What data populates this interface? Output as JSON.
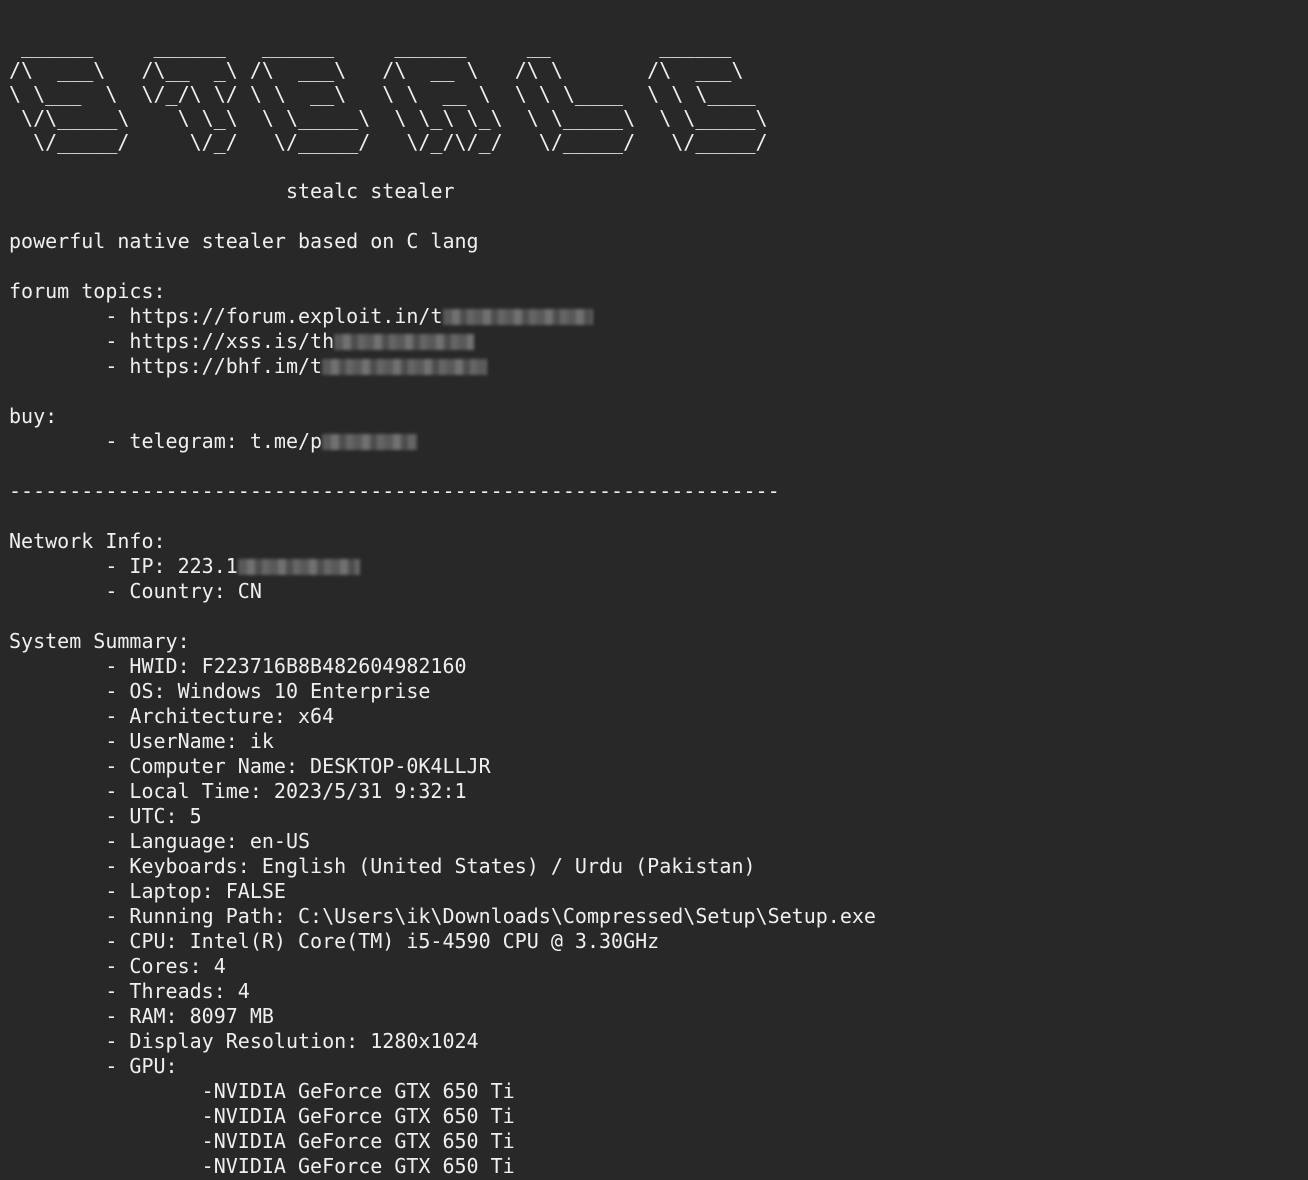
{
  "banner_lines": [
    " ______     ______   ______     ______     __         ______    ",
    "/\\  ___\\   /\\__  _\\ /\\  ___\\   /\\  __ \\   /\\ \\       /\\  ___\\   ",
    "\\ \\___  \\  \\/_/\\ \\/ \\ \\  __\\   \\ \\  __ \\  \\ \\ \\____  \\ \\ \\____  ",
    " \\/\\_____\\    \\ \\_\\  \\ \\_____\\  \\ \\_\\ \\_\\  \\ \\_____\\  \\ \\_____\\ ",
    "  \\/_____/     \\/_/   \\/_____/   \\/_/\\/_/   \\/_____/   \\/_____/ "
  ],
  "tool_name": "stealc stealer",
  "tagline": "powerful native stealer based on C lang",
  "forum_heading": "forum topics:",
  "forum_links": [
    {
      "prefix": "- ",
      "visible": "https://forum.exploit.in/t",
      "tail": ""
    },
    {
      "prefix": "- ",
      "visible": "https://xss.is/th",
      "tail": ""
    },
    {
      "prefix": "- ",
      "visible": "https://bhf.im/t",
      "tail": ""
    }
  ],
  "buy_heading": "buy:",
  "buy_items": [
    {
      "prefix": "- ",
      "visible": "telegram: t.me/p",
      "tail": ""
    }
  ],
  "separator": "----------------------------------------------------------------",
  "network_heading": "Network Info:",
  "network_items": [
    {
      "prefix": "- ",
      "visible": "IP: 223.1",
      "tail": ""
    },
    {
      "prefix": "- ",
      "visible": "Country: CN",
      "tail": ""
    }
  ],
  "system_heading": "System Summary:",
  "system_items": [
    "- HWID: F223716B8B482604982160",
    "- OS: Windows 10 Enterprise",
    "- Architecture: x64",
    "- UserName: ik",
    "- Computer Name: DESKTOP-0K4LLJR",
    "- Local Time: 2023/5/31 9:32:1",
    "- UTC: 5",
    "- Language: en-US",
    "- Keyboards: English (United States) / Urdu (Pakistan)",
    "- Laptop: FALSE",
    "- Running Path: C:\\Users\\ik\\Downloads\\Compressed\\Setup\\Setup.exe",
    "- CPU: Intel(R) Core(TM) i5-4590 CPU @ 3.30GHz",
    "- Cores: 4",
    "- Threads: 4",
    "- RAM: 8097 MB",
    "- Display Resolution: 1280x1024",
    "- GPU:"
  ],
  "gpu_items": [
    "-NVIDIA GeForce GTX 650 Ti",
    "-NVIDIA GeForce GTX 650 Ti",
    "-NVIDIA GeForce GTX 650 Ti",
    "-NVIDIA GeForce GTX 650 Ti"
  ],
  "colors": {
    "background": "#282828",
    "foreground": "#efefef"
  }
}
